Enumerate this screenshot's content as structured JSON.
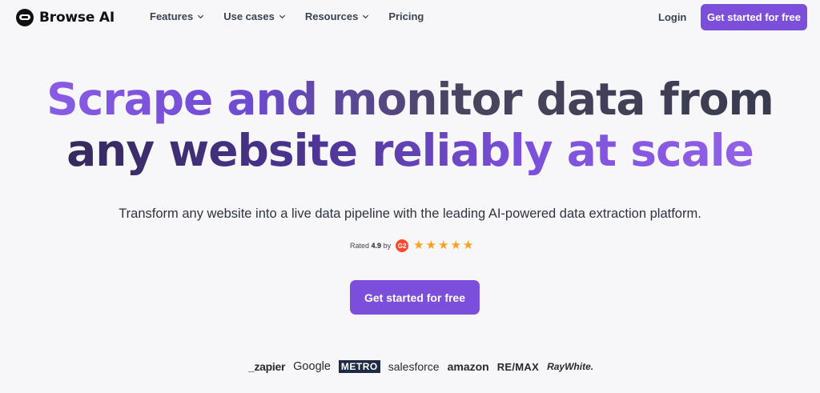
{
  "nav": {
    "brand": "Browse AI",
    "links": [
      {
        "label": "Features",
        "has_dropdown": true
      },
      {
        "label": "Use cases",
        "has_dropdown": true
      },
      {
        "label": "Resources",
        "has_dropdown": true
      },
      {
        "label": "Pricing",
        "has_dropdown": false
      }
    ],
    "login": "Login",
    "cta": "Get started for free"
  },
  "hero": {
    "line1_a": "Scrape and monitor data from",
    "line2_a": "any website reliably at scale",
    "subtitle": "Transform any website into a live data pipeline with the leading AI-powered data extraction platform.",
    "rating_prefix": "Rated",
    "rating_value": "4.9",
    "rating_suffix": "by",
    "g2_label": "G2",
    "stars": 5,
    "cta": "Get started for free"
  },
  "logos": [
    "_zapier",
    "Google",
    "METRO",
    "salesforce",
    "amazon",
    "RE/MAX",
    "RayWhite."
  ],
  "colors": {
    "accent": "#7c4fdb",
    "background": "#f7f7f9",
    "star": "#ff9f1c",
    "g2": "#ff492c"
  }
}
